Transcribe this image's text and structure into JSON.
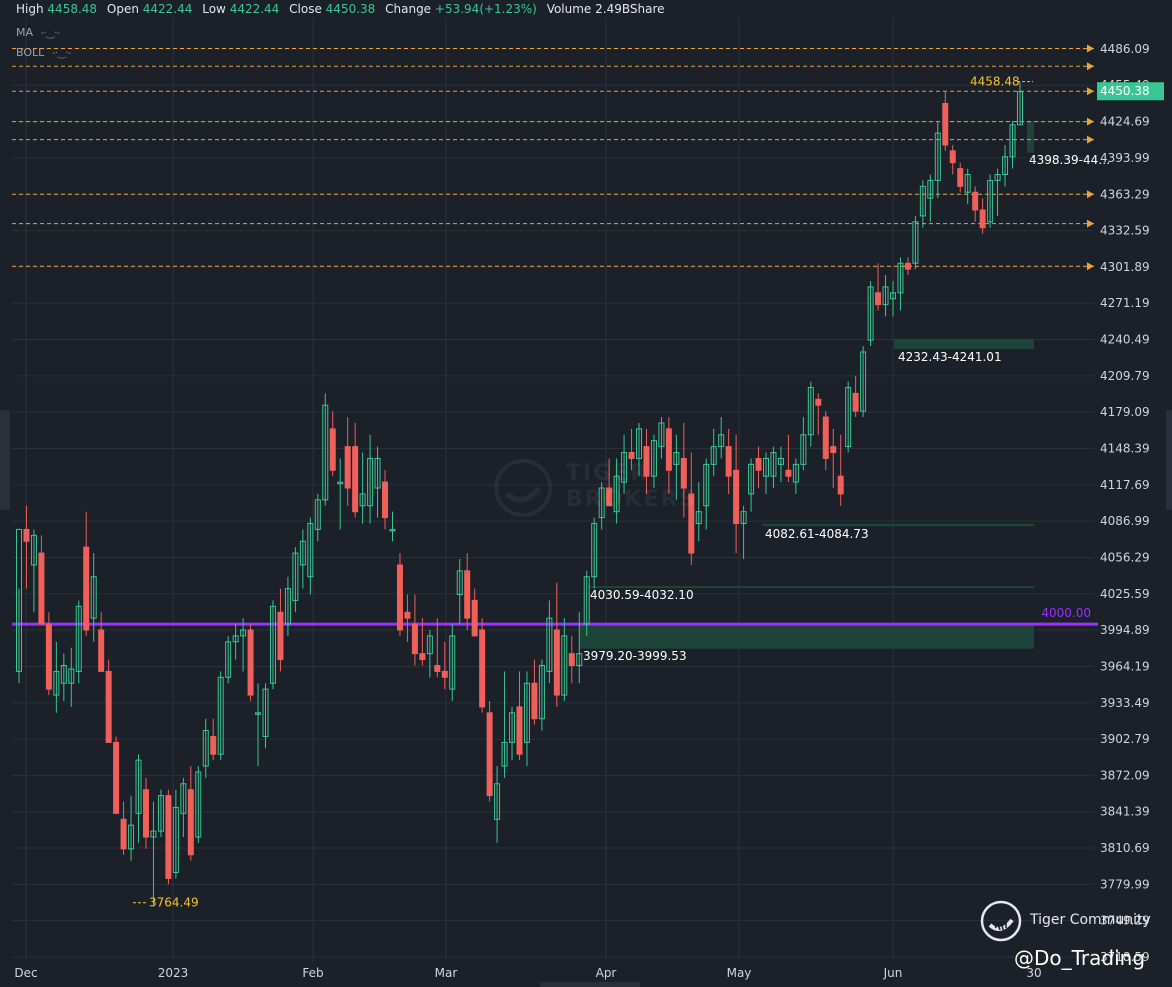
{
  "header": {
    "high_label": "High",
    "high_value": "4458.48",
    "open_label": "Open",
    "open_value": "4422.44",
    "low_label": "Low",
    "low_value": "4422.44",
    "close_label": "Close",
    "close_value": "4450.38",
    "change_label": "Change",
    "change_value": "+53.94(+1.23%)",
    "volume_label": "Volume",
    "volume_value": "2.49BShare"
  },
  "indicators": [
    {
      "name": "MA"
    },
    {
      "name": "BOLL"
    }
  ],
  "watermark": {
    "line1": "TIGER",
    "line2": "BROKERS"
  },
  "brand": {
    "name": "Tiger Community"
  },
  "handle": "@Do_Trading",
  "colors": {
    "background": "#1b2029",
    "grid": "#2b313b",
    "up": "#38c793",
    "down": "#f0605a",
    "zone": "#1f4a3c",
    "level_line": "#e8a33c",
    "round_level": "#9b30ff",
    "price_tag": "#38c793",
    "annotation": "#f5c32c"
  },
  "chart_data": {
    "type": "candlestick",
    "y_axis_ticks": [
      "4486.09",
      "4455.49",
      "4424.69",
      "4393.99",
      "4363.29",
      "4332.59",
      "4301.89",
      "4271.19",
      "4240.49",
      "4209.79",
      "4179.09",
      "4148.39",
      "4117.69",
      "4086.99",
      "4056.29",
      "4025.59",
      "3994.89",
      "3964.19",
      "3933.49",
      "3902.79",
      "3872.09",
      "3841.39",
      "3810.69",
      "3779.99",
      "3749.29",
      "3718.59"
    ],
    "x_axis_labels": [
      "Dec",
      "2023",
      "Feb",
      "Mar",
      "Apr",
      "May",
      "Jun",
      "30"
    ],
    "ylim": [
      3712,
      4514
    ],
    "last_price": "4450.38",
    "horizontal_levels": [
      4486.5,
      4471.5,
      4450.38,
      4424.69,
      4409.5,
      4363.29,
      4338.5,
      4302.5
    ],
    "round_level": {
      "value": 4000,
      "label": "4000.00"
    },
    "zones": [
      {
        "label": "4232.43-4241.01",
        "low": 4232.43,
        "high": 4241.01
      },
      {
        "label": "4082.61-4084.73",
        "low": 4082.61,
        "high": 4084.73
      },
      {
        "label": "4030.59-4032.10",
        "low": 4030.59,
        "high": 4032.1
      },
      {
        "label": "3979.20-3999.53",
        "low": 3979.2,
        "high": 3999.53
      },
      {
        "label": "4398.39-44…",
        "low": 4398.39,
        "high": 4424.69
      }
    ],
    "annotations": [
      {
        "label": "4458.48",
        "value": 4458.48
      },
      {
        "label": "3764.49",
        "value": 3764.49
      }
    ],
    "candles": [
      {
        "o": 3960,
        "h": 4030,
        "l": 3950,
        "c": 4080
      },
      {
        "o": 4080,
        "h": 4100,
        "l": 4030,
        "c": 4070
      },
      {
        "o": 4050,
        "h": 4080,
        "l": 4010,
        "c": 4075
      },
      {
        "o": 4060,
        "h": 4075,
        "l": 4000,
        "c": 4000
      },
      {
        "o": 4000,
        "h": 4010,
        "l": 3940,
        "c": 3945
      },
      {
        "o": 3940,
        "h": 3985,
        "l": 3925,
        "c": 3960
      },
      {
        "o": 3950,
        "h": 3975,
        "l": 3935,
        "c": 3965
      },
      {
        "o": 3950,
        "h": 3980,
        "l": 3930,
        "c": 3962
      },
      {
        "o": 3960,
        "h": 4020,
        "l": 3950,
        "c": 4015
      },
      {
        "o": 4065,
        "h": 4095,
        "l": 3990,
        "c": 3995
      },
      {
        "o": 4005,
        "h": 4060,
        "l": 3985,
        "c": 4040
      },
      {
        "o": 3995,
        "h": 4010,
        "l": 3960,
        "c": 3960
      },
      {
        "o": 3960,
        "h": 3970,
        "l": 3900,
        "c": 3900
      },
      {
        "o": 3900,
        "h": 3905,
        "l": 3840,
        "c": 3840
      },
      {
        "o": 3835,
        "h": 3850,
        "l": 3805,
        "c": 3810
      },
      {
        "o": 3810,
        "h": 3855,
        "l": 3800,
        "c": 3830
      },
      {
        "o": 3840,
        "h": 3890,
        "l": 3815,
        "c": 3885
      },
      {
        "o": 3860,
        "h": 3870,
        "l": 3810,
        "c": 3820
      },
      {
        "o": 3820,
        "h": 3850,
        "l": 3762,
        "c": 3825
      },
      {
        "o": 3825,
        "h": 3860,
        "l": 3820,
        "c": 3855
      },
      {
        "o": 3855,
        "h": 3860,
        "l": 3780,
        "c": 3785
      },
      {
        "o": 3790,
        "h": 3860,
        "l": 3785,
        "c": 3845
      },
      {
        "o": 3840,
        "h": 3870,
        "l": 3820,
        "c": 3865
      },
      {
        "o": 3860,
        "h": 3880,
        "l": 3800,
        "c": 3805
      },
      {
        "o": 3820,
        "h": 3880,
        "l": 3815,
        "c": 3875
      },
      {
        "o": 3880,
        "h": 3920,
        "l": 3870,
        "c": 3910
      },
      {
        "o": 3905,
        "h": 3920,
        "l": 3885,
        "c": 3890
      },
      {
        "o": 3890,
        "h": 3960,
        "l": 3885,
        "c": 3955
      },
      {
        "o": 3955,
        "h": 3990,
        "l": 3950,
        "c": 3985
      },
      {
        "o": 3985,
        "h": 4000,
        "l": 3970,
        "c": 3990
      },
      {
        "o": 3990,
        "h": 4005,
        "l": 3960,
        "c": 3995
      },
      {
        "o": 3995,
        "h": 4000,
        "l": 3935,
        "c": 3940
      },
      {
        "o": 3925,
        "h": 3950,
        "l": 3880,
        "c": 3925
      },
      {
        "o": 3905,
        "h": 3950,
        "l": 3895,
        "c": 3945
      },
      {
        "o": 3950,
        "h": 4020,
        "l": 3945,
        "c": 4015
      },
      {
        "o": 4010,
        "h": 4030,
        "l": 3960,
        "c": 3970
      },
      {
        "o": 4000,
        "h": 4040,
        "l": 3990,
        "c": 4030
      },
      {
        "o": 4020,
        "h": 4065,
        "l": 4010,
        "c": 4060
      },
      {
        "o": 4050,
        "h": 4080,
        "l": 4030,
        "c": 4070
      },
      {
        "o": 4040,
        "h": 4090,
        "l": 4025,
        "c": 4085
      },
      {
        "o": 4080,
        "h": 4110,
        "l": 4070,
        "c": 4105
      },
      {
        "o": 4105,
        "h": 4195,
        "l": 4100,
        "c": 4185
      },
      {
        "o": 4165,
        "h": 4180,
        "l": 4125,
        "c": 4130
      },
      {
        "o": 4120,
        "h": 4140,
        "l": 4080,
        "c": 4120
      },
      {
        "o": 4150,
        "h": 4175,
        "l": 4100,
        "c": 4115
      },
      {
        "o": 4150,
        "h": 4170,
        "l": 4090,
        "c": 4095
      },
      {
        "o": 4100,
        "h": 4145,
        "l": 4085,
        "c": 4110
      },
      {
        "o": 4100,
        "h": 4160,
        "l": 4085,
        "c": 4140
      },
      {
        "o": 4115,
        "h": 4150,
        "l": 4090,
        "c": 4140
      },
      {
        "o": 4120,
        "h": 4130,
        "l": 4080,
        "c": 4090
      },
      {
        "o": 4080,
        "h": 4095,
        "l": 4070,
        "c": 4080
      },
      {
        "o": 4050,
        "h": 4060,
        "l": 3990,
        "c": 3995
      },
      {
        "o": 4010,
        "h": 4025,
        "l": 3985,
        "c": 4005
      },
      {
        "o": 4000,
        "h": 4025,
        "l": 3965,
        "c": 3975
      },
      {
        "o": 3975,
        "h": 4005,
        "l": 3965,
        "c": 3970
      },
      {
        "o": 3975,
        "h": 3995,
        "l": 3955,
        "c": 3990
      },
      {
        "o": 3965,
        "h": 4005,
        "l": 3955,
        "c": 3960
      },
      {
        "o": 3960,
        "h": 3985,
        "l": 3945,
        "c": 3955
      },
      {
        "o": 3945,
        "h": 4000,
        "l": 3935,
        "c": 3990
      },
      {
        "o": 4025,
        "h": 4055,
        "l": 4000,
        "c": 4045
      },
      {
        "o": 4045,
        "h": 4060,
        "l": 3995,
        "c": 4005
      },
      {
        "o": 4020,
        "h": 4030,
        "l": 3990,
        "c": 3990
      },
      {
        "o": 3995,
        "h": 4005,
        "l": 3925,
        "c": 3930
      },
      {
        "o": 3925,
        "h": 3935,
        "l": 3850,
        "c": 3855
      },
      {
        "o": 3835,
        "h": 3880,
        "l": 3815,
        "c": 3865
      },
      {
        "o": 3880,
        "h": 3960,
        "l": 3870,
        "c": 3900
      },
      {
        "o": 3900,
        "h": 3930,
        "l": 3885,
        "c": 3925
      },
      {
        "o": 3930,
        "h": 3960,
        "l": 3885,
        "c": 3890
      },
      {
        "o": 3900,
        "h": 3960,
        "l": 3880,
        "c": 3950
      },
      {
        "o": 3950,
        "h": 3970,
        "l": 3915,
        "c": 3920
      },
      {
        "o": 3920,
        "h": 3970,
        "l": 3910,
        "c": 3965
      },
      {
        "o": 3960,
        "h": 4020,
        "l": 3950,
        "c": 4005
      },
      {
        "o": 3995,
        "h": 4035,
        "l": 3930,
        "c": 3940
      },
      {
        "o": 3940,
        "h": 4005,
        "l": 3935,
        "c": 3990
      },
      {
        "o": 3975,
        "h": 3990,
        "l": 3950,
        "c": 3965
      },
      {
        "o": 3965,
        "h": 4010,
        "l": 3950,
        "c": 3975
      },
      {
        "o": 4000,
        "h": 4045,
        "l": 3990,
        "c": 4040
      },
      {
        "o": 4040,
        "h": 4090,
        "l": 4030,
        "c": 4085
      },
      {
        "o": 4090,
        "h": 4120,
        "l": 4080,
        "c": 4115
      },
      {
        "o": 4115,
        "h": 4140,
        "l": 4100,
        "c": 4100
      },
      {
        "o": 4095,
        "h": 4140,
        "l": 4085,
        "c": 4125
      },
      {
        "o": 4120,
        "h": 4160,
        "l": 4110,
        "c": 4145
      },
      {
        "o": 4145,
        "h": 4165,
        "l": 4130,
        "c": 4140
      },
      {
        "o": 4140,
        "h": 4170,
        "l": 4125,
        "c": 4165
      },
      {
        "o": 4150,
        "h": 4165,
        "l": 4110,
        "c": 4125
      },
      {
        "o": 4125,
        "h": 4160,
        "l": 4115,
        "c": 4155
      },
      {
        "o": 4150,
        "h": 4175,
        "l": 4140,
        "c": 4170
      },
      {
        "o": 4165,
        "h": 4175,
        "l": 4110,
        "c": 4130
      },
      {
        "o": 4135,
        "h": 4160,
        "l": 4105,
        "c": 4145
      },
      {
        "o": 4140,
        "h": 4170,
        "l": 4090,
        "c": 4115
      },
      {
        "o": 4110,
        "h": 4145,
        "l": 4050,
        "c": 4060
      },
      {
        "o": 4085,
        "h": 4120,
        "l": 4070,
        "c": 4095
      },
      {
        "o": 4100,
        "h": 4140,
        "l": 4080,
        "c": 4135
      },
      {
        "o": 4135,
        "h": 4165,
        "l": 4125,
        "c": 4150
      },
      {
        "o": 4150,
        "h": 4175,
        "l": 4140,
        "c": 4160
      },
      {
        "o": 4150,
        "h": 4165,
        "l": 4110,
        "c": 4125
      },
      {
        "o": 4130,
        "h": 4160,
        "l": 4060,
        "c": 4085
      },
      {
        "o": 4085,
        "h": 4100,
        "l": 4055,
        "c": 4095
      },
      {
        "o": 4110,
        "h": 4140,
        "l": 4095,
        "c": 4135
      },
      {
        "o": 4140,
        "h": 4150,
        "l": 4115,
        "c": 4130
      },
      {
        "o": 4125,
        "h": 4145,
        "l": 4110,
        "c": 4140
      },
      {
        "o": 4125,
        "h": 4150,
        "l": 4115,
        "c": 4145
      },
      {
        "o": 4135,
        "h": 4150,
        "l": 4120,
        "c": 4140
      },
      {
        "o": 4130,
        "h": 4160,
        "l": 4120,
        "c": 4125
      },
      {
        "o": 4120,
        "h": 4140,
        "l": 4110,
        "c": 4135
      },
      {
        "o": 4135,
        "h": 4175,
        "l": 4130,
        "c": 4160
      },
      {
        "o": 4160,
        "h": 4205,
        "l": 4150,
        "c": 4200
      },
      {
        "o": 4190,
        "h": 4195,
        "l": 4160,
        "c": 4185
      },
      {
        "o": 4175,
        "h": 4180,
        "l": 4130,
        "c": 4140
      },
      {
        "o": 4150,
        "h": 4165,
        "l": 4115,
        "c": 4145
      },
      {
        "o": 4125,
        "h": 4160,
        "l": 4100,
        "c": 4110
      },
      {
        "o": 4150,
        "h": 4205,
        "l": 4145,
        "c": 4200
      },
      {
        "o": 4195,
        "h": 4210,
        "l": 4175,
        "c": 4180
      },
      {
        "o": 4180,
        "h": 4235,
        "l": 4175,
        "c": 4230
      },
      {
        "o": 4240,
        "h": 4290,
        "l": 4235,
        "c": 4285
      },
      {
        "o": 4280,
        "h": 4305,
        "l": 4265,
        "c": 4270
      },
      {
        "o": 4270,
        "h": 4295,
        "l": 4260,
        "c": 4285
      },
      {
        "o": 4275,
        "h": 4290,
        "l": 4260,
        "c": 4280
      },
      {
        "o": 4280,
        "h": 4310,
        "l": 4265,
        "c": 4305
      },
      {
        "o": 4305,
        "h": 4310,
        "l": 4295,
        "c": 4300
      },
      {
        "o": 4305,
        "h": 4345,
        "l": 4300,
        "c": 4340
      },
      {
        "o": 4345,
        "h": 4375,
        "l": 4335,
        "c": 4370
      },
      {
        "o": 4360,
        "h": 4380,
        "l": 4340,
        "c": 4375
      },
      {
        "o": 4375,
        "h": 4425,
        "l": 4360,
        "c": 4415
      },
      {
        "o": 4440,
        "h": 4450,
        "l": 4400,
        "c": 4405
      },
      {
        "o": 4400,
        "h": 4405,
        "l": 4380,
        "c": 4390
      },
      {
        "o": 4385,
        "h": 4390,
        "l": 4365,
        "c": 4370
      },
      {
        "o": 4365,
        "h": 4385,
        "l": 4355,
        "c": 4380
      },
      {
        "o": 4365,
        "h": 4370,
        "l": 4340,
        "c": 4350
      },
      {
        "o": 4350,
        "h": 4360,
        "l": 4330,
        "c": 4335
      },
      {
        "o": 4340,
        "h": 4380,
        "l": 4335,
        "c": 4375
      },
      {
        "o": 4375,
        "h": 4385,
        "l": 4345,
        "c": 4380
      },
      {
        "o": 4380,
        "h": 4405,
        "l": 4370,
        "c": 4395
      },
      {
        "o": 4395,
        "h": 4425,
        "l": 4385,
        "c": 4422
      },
      {
        "o": 4422,
        "h": 4458,
        "l": 4422,
        "c": 4450
      }
    ]
  }
}
